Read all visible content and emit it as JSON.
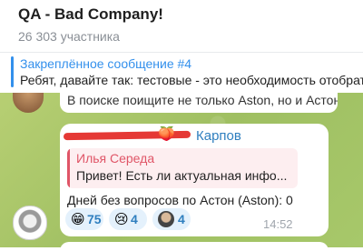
{
  "header": {
    "title": "QA - Bad Company!",
    "subtitle": "26 303 участника"
  },
  "pinned": {
    "title": "Закреплённое сообщение #4",
    "text": "Ребят, давайте так: тестовые - это необходимость отобрат"
  },
  "previous_message": {
    "text": "В поиске поищите не только Aston, но и Астон"
  },
  "message": {
    "sender_emoji": "🍑",
    "sender_name": "Карпов",
    "reply": {
      "author": "Илья Середа",
      "text": "Привет!  Есть ли актуальная инфо..."
    },
    "text": "Дней без вопросов по Астон (Aston): 0",
    "reactions": [
      {
        "emoji": "😁",
        "count": "75",
        "icon": "grinning-face-icon"
      },
      {
        "emoji": "😢",
        "count": "4",
        "icon": "crying-face-icon"
      },
      {
        "emoji": "",
        "count": "4",
        "icon": "reactor-avatar-icon"
      }
    ],
    "time": "14:52"
  },
  "colors": {
    "accent": "#3390ec",
    "reply_accent": "#e05567",
    "chat_background": "#a9c46a",
    "reaction_bg": "#e4f1fc"
  }
}
